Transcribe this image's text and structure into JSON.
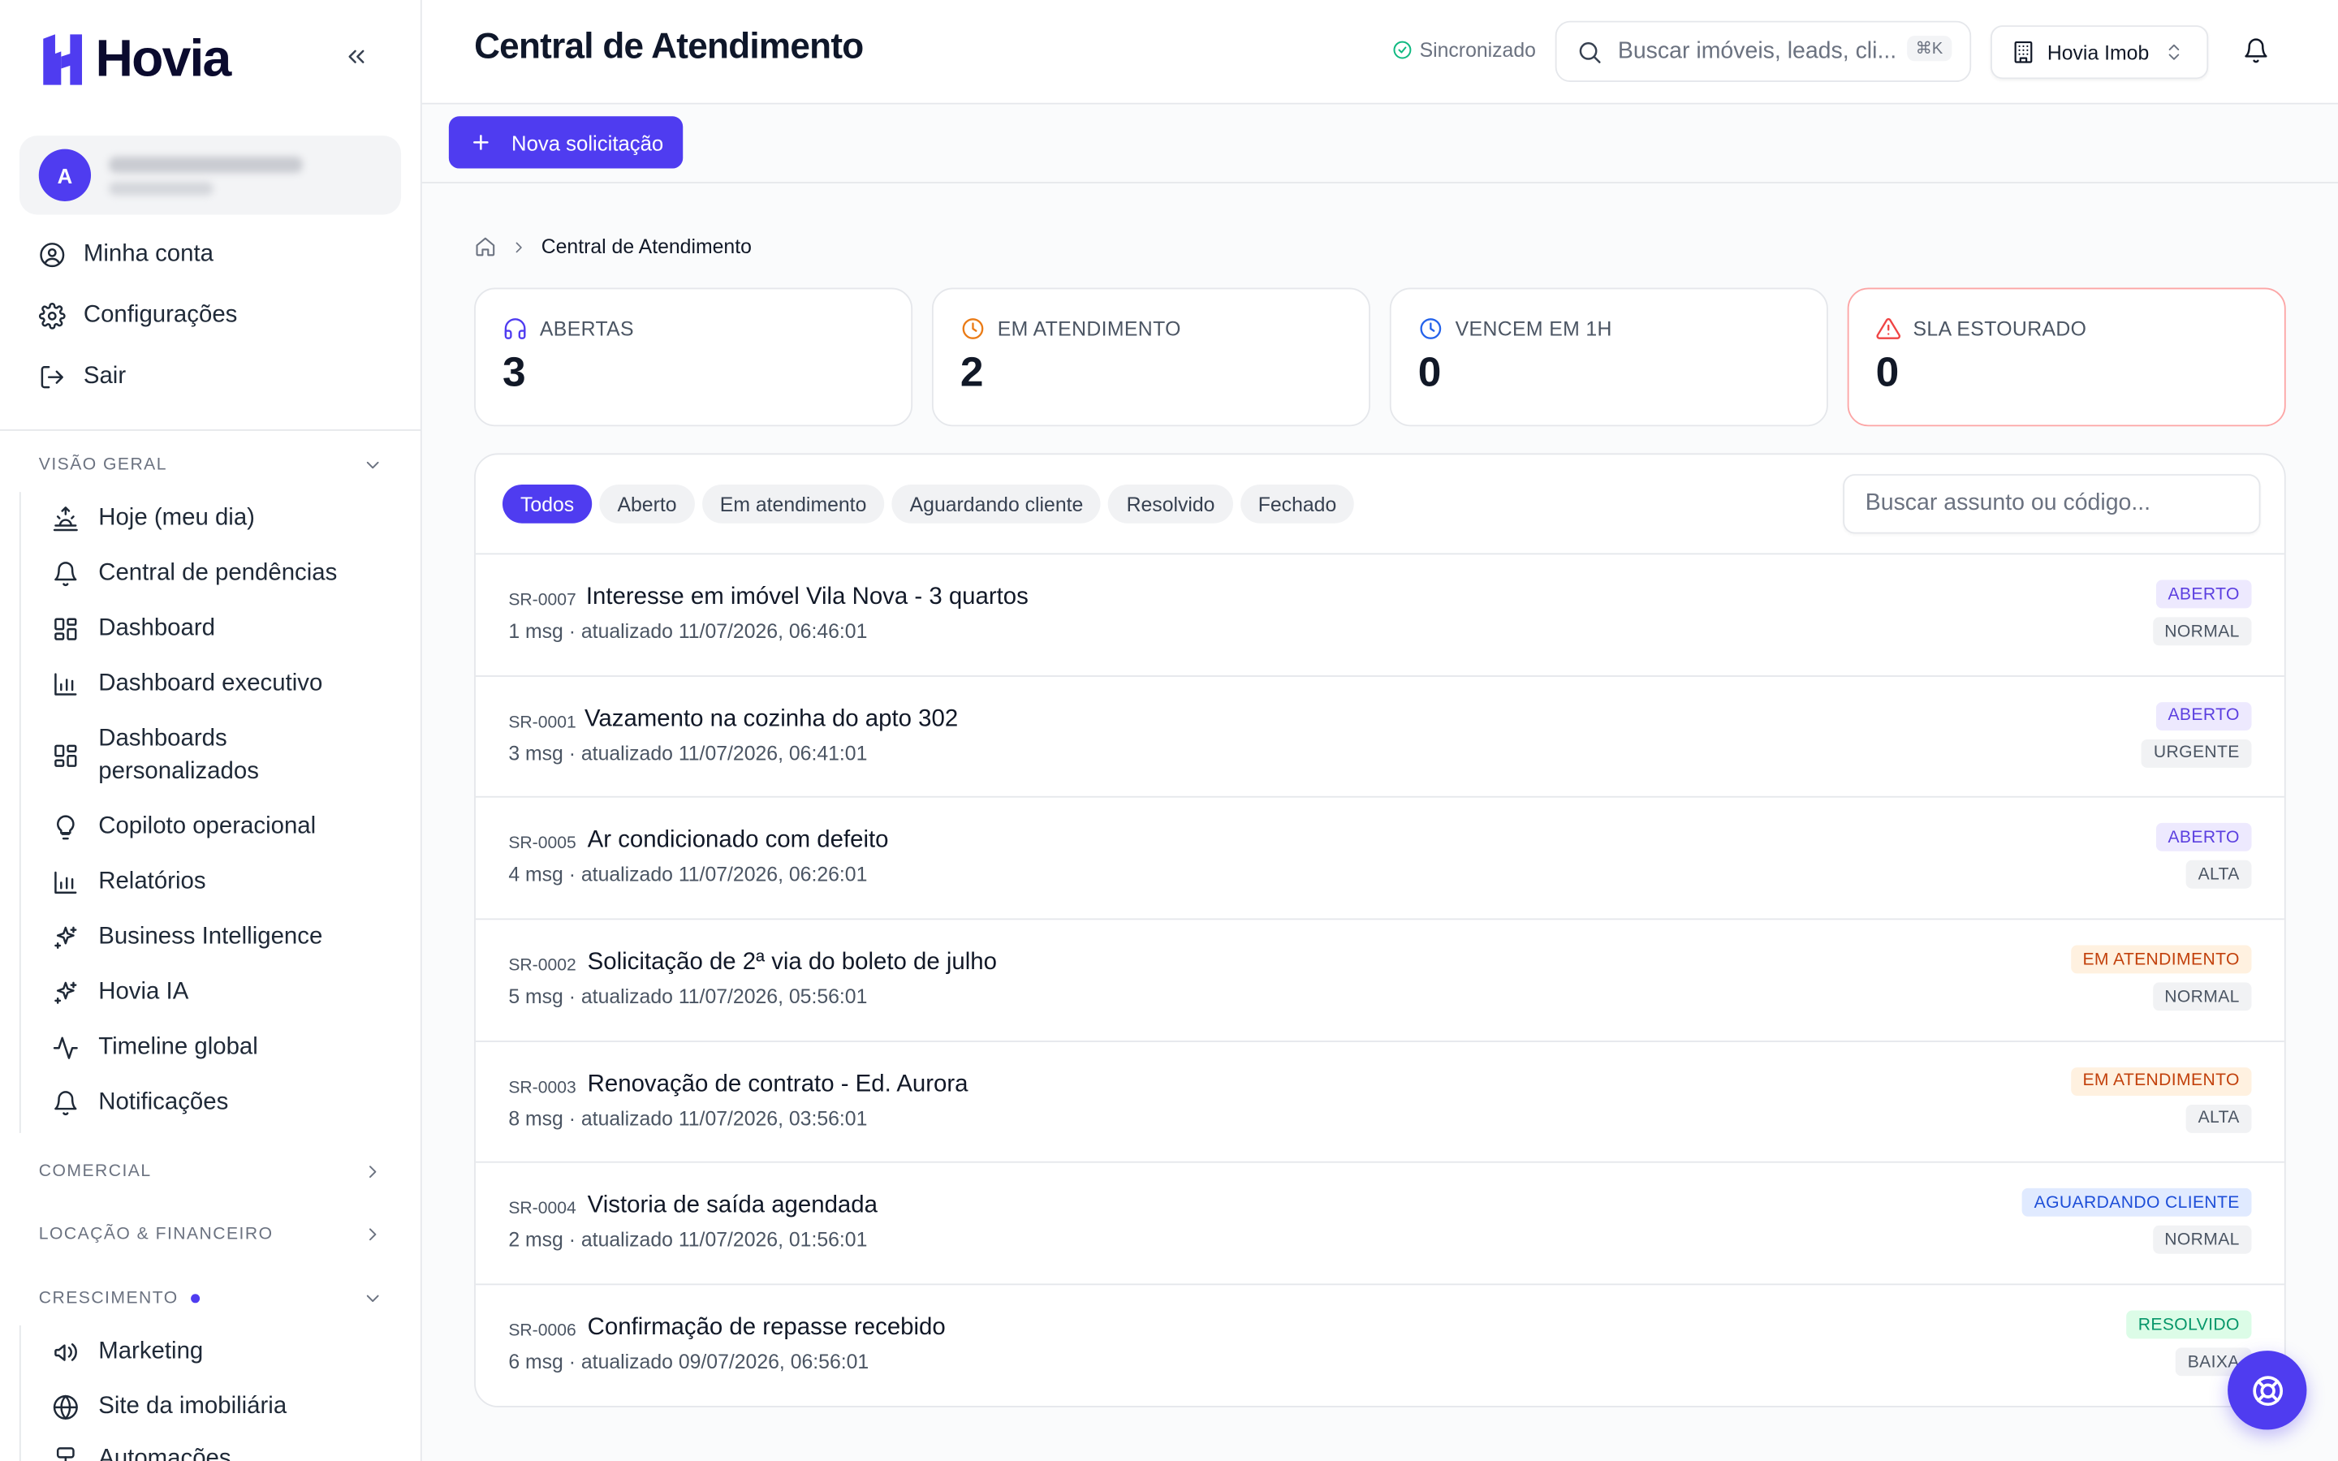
{
  "brand": {
    "name": "Hovia",
    "accent": "#4f3cf0"
  },
  "user": {
    "initial": "A"
  },
  "account_menu": [
    {
      "label": "Minha conta",
      "icon": "user-circle-icon"
    },
    {
      "label": "Configurações",
      "icon": "gear-icon"
    },
    {
      "label": "Sair",
      "icon": "logout-icon"
    }
  ],
  "sidebar": {
    "sections": {
      "visao_geral": "VISÃO GERAL",
      "comercial": "COMERCIAL",
      "locacao": "LOCAÇÃO & FINANCEIRO",
      "crescimento": "CRESCIMENTO"
    },
    "visao_geral_items": [
      {
        "label": "Hoje (meu dia)",
        "icon": "sunrise-icon"
      },
      {
        "label": "Central de pendências",
        "icon": "bell-icon"
      },
      {
        "label": "Dashboard",
        "icon": "dashboard-icon"
      },
      {
        "label": "Dashboard executivo",
        "icon": "bar-chart-icon"
      },
      {
        "label": "Dashboards personalizados",
        "icon": "dashboard-icon"
      },
      {
        "label": "Copiloto operacional",
        "icon": "lightbulb-icon"
      },
      {
        "label": "Relatórios",
        "icon": "bar-chart-icon"
      },
      {
        "label": "Business Intelligence",
        "icon": "sparkles-icon"
      },
      {
        "label": "Hovia IA",
        "icon": "sparkles-icon"
      },
      {
        "label": "Timeline global",
        "icon": "activity-icon"
      },
      {
        "label": "Notificações",
        "icon": "bell-icon"
      }
    ],
    "crescimento_items": [
      {
        "label": "Marketing",
        "icon": "megaphone-icon"
      },
      {
        "label": "Site da imobiliária",
        "icon": "globe-icon"
      },
      {
        "label": "Automações",
        "icon": "automation-icon"
      }
    ]
  },
  "header": {
    "title": "Central de Atendimento",
    "sync_status": "Sincronizado",
    "search_placeholder": "Buscar imóveis, leads, cli...",
    "search_shortcut": "⌘K",
    "org_name": "Hovia Imob"
  },
  "toolbar": {
    "new_request_label": "Nova solicitação"
  },
  "breadcrumb": {
    "current": "Central de Atendimento"
  },
  "stats": [
    {
      "label": "ABERTAS",
      "value": "3",
      "icon": "headset-icon",
      "color": "#4f3cf0"
    },
    {
      "label": "EM ATENDIMENTO",
      "value": "2",
      "icon": "clock-icon",
      "color": "#ea7b16"
    },
    {
      "label": "VENCEM EM 1H",
      "value": "0",
      "icon": "clock-icon",
      "color": "#2563eb"
    },
    {
      "label": "SLA ESTOURADO",
      "value": "0",
      "icon": "alert-triangle-icon",
      "color": "#ef4444"
    }
  ],
  "filters": {
    "tabs": [
      "Todos",
      "Aberto",
      "Em atendimento",
      "Aguardando cliente",
      "Resolvido",
      "Fechado"
    ],
    "active": "Todos",
    "search_placeholder": "Buscar assunto ou código..."
  },
  "tickets": [
    {
      "code": "SR-0007",
      "subject": "Interesse em imóvel Vila Nova - 3 quartos",
      "meta": "1 msg · atualizado 11/07/2026, 06:46:01",
      "status": "ABERTO",
      "priority": "NORMAL"
    },
    {
      "code": "SR-0001",
      "subject": "Vazamento na cozinha do apto 302",
      "meta": "3 msg · atualizado 11/07/2026, 06:41:01",
      "status": "ABERTO",
      "priority": "URGENTE"
    },
    {
      "code": "SR-0005",
      "subject": "Ar condicionado com defeito",
      "meta": "4 msg · atualizado 11/07/2026, 06:26:01",
      "status": "ABERTO",
      "priority": "ALTA"
    },
    {
      "code": "SR-0002",
      "subject": "Solicitação de 2ª via do boleto de julho",
      "meta": "5 msg · atualizado 11/07/2026, 05:56:01",
      "status": "EM ATENDIMENTO",
      "priority": "NORMAL"
    },
    {
      "code": "SR-0003",
      "subject": "Renovação de contrato - Ed. Aurora",
      "meta": "8 msg · atualizado 11/07/2026, 03:56:01",
      "status": "EM ATENDIMENTO",
      "priority": "ALTA"
    },
    {
      "code": "SR-0004",
      "subject": "Vistoria de saída agendada",
      "meta": "2 msg · atualizado 11/07/2026, 01:56:01",
      "status": "AGUARDANDO CLIENTE",
      "priority": "NORMAL"
    },
    {
      "code": "SR-0006",
      "subject": "Confirmação de repasse recebido",
      "meta": "6 msg · atualizado 09/07/2026, 06:56:01",
      "status": "RESOLVIDO",
      "priority": "BAIXA"
    }
  ],
  "status_colors": {
    "ABERTO": {
      "bg": "#ede9fe",
      "fg": "#5b3fe0"
    },
    "EM ATENDIMENTO": {
      "bg": "#fff1e0",
      "fg": "#c2410c"
    },
    "AGUARDANDO CLIENTE": {
      "bg": "#e0eaff",
      "fg": "#1d4ed8"
    },
    "RESOLVIDO": {
      "bg": "#dcfce7",
      "fg": "#059669"
    }
  }
}
